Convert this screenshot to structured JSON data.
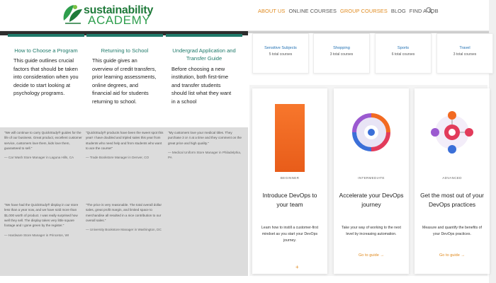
{
  "logo": {
    "line1": "sustainability",
    "line2": "ACADEMY"
  },
  "nav": [
    {
      "label": "ABOUT US",
      "active": true
    },
    {
      "label": "ONLINE COURSES",
      "active": false
    },
    {
      "label": "GROUP COURSES",
      "active": true
    },
    {
      "label": "BLOG",
      "active": false
    },
    {
      "label": "FIND A JOB",
      "active": false
    }
  ],
  "icons": {
    "search": "search-icon",
    "logo": "leaf-logo-icon",
    "plus": "plus-icon"
  },
  "colors": {
    "accent_orange": "#e08a1e",
    "teal": "#1f7a6a",
    "green": "#2e9e4d",
    "link_blue": "#1f6fb2"
  },
  "guides": [
    {
      "title": "How to Choose a Program",
      "body": "This guide outlines crucial factors that should be taken into consideration when you decide to start looking at psychology programs."
    },
    {
      "title": "Returning to School",
      "body": "This guide gives an overview of credit transfers, prior learning assessments, online degrees, and financial aid for students returning to school."
    },
    {
      "title": "Undergrad Application and Transfer Guide",
      "body": "Before choosing a new institution, both first-time and transfer students should list what they want in a school"
    }
  ],
  "testimonials": [
    {
      "text": "\"We will continue to carry QuickStudy® guides for the life of our business. Great product, excellent customer service, customers love them, kids love them, guaranteed to sell.\"",
      "source": "— Car Wash Store Manager in Laguna Hills, CA"
    },
    {
      "text": "\"QuickStudy® products have been the sweet spot this year! I have doubled and tripled sales this year from students who need help and from students who want to ace the course!\"",
      "source": "— Trade Bookstore Manager in Denver, CO"
    },
    {
      "text": "\"My customers love your medical titles. They purchase 3 or 4 at a time and they comment on the great price and high quality.\"",
      "source": "— Medical Uniform Store Manager in Philadelphia, PA"
    },
    {
      "text": "\"We have had the QuickStudy® display in our store less than a year now, and we have sold more than $1,000 worth of product. I was really surprised how well they sell. The display takes very little square footage and I gone green by the register.\"",
      "source": "— Hardware Store Manager in Princeton, WI"
    },
    {
      "text": "\"The price is very reasonable. The total overall dollar sales, great profit margin, and limited space to merchandise all resulted in a nice contribution to our overall sales.\"",
      "source": "— University Bookstore Manager in Washington, DC"
    }
  ],
  "categories": [
    {
      "title": "Sensitive Subjects",
      "count": "5 total courses"
    },
    {
      "title": "Shopping",
      "count": "3 total courses"
    },
    {
      "title": "Sports",
      "count": "6 total courses"
    },
    {
      "title": "Travel",
      "count": "3 total courses"
    }
  ],
  "courses": [
    {
      "level": "BEGINNER",
      "title": "Introduce DevOps to your team",
      "desc": "Learn how to instill a customer-first mindset as you start your DevOps journey.",
      "link": ""
    },
    {
      "level": "INTERMEDIATE",
      "title": "Accelerate your DevOps journey",
      "desc": "Take your way of working to the next level by increasing automation.",
      "link": "Go to guide →"
    },
    {
      "level": "ADVANCED",
      "title": "Get the most out of your DevOps practices",
      "desc": "Measure and quantify the benefits of your DevOps practices.",
      "link": "Go to guide →"
    }
  ],
  "plus_label": "+"
}
